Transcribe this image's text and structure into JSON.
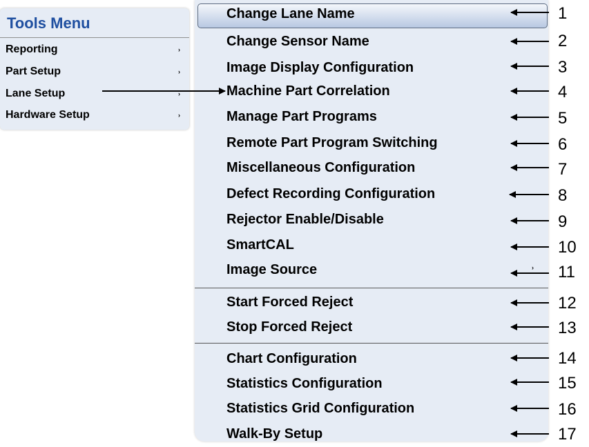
{
  "tools_menu": {
    "title": "Tools Menu",
    "items": [
      {
        "label": "Reporting",
        "submenu_glyph": "›"
      },
      {
        "label": "Part Setup",
        "submenu_glyph": "›"
      },
      {
        "label": "Lane Setup",
        "submenu_glyph": "›"
      },
      {
        "label": "Hardware Setup",
        "submenu_glyph": "›"
      }
    ]
  },
  "lane_setup_submenu": {
    "items": [
      {
        "label": "Change Lane Name",
        "callout": "1"
      },
      {
        "label": "Change Sensor Name",
        "callout": "2"
      },
      {
        "label": "Image Display Configuration",
        "callout": "3"
      },
      {
        "label": "Machine Part Correlation",
        "callout": "4"
      },
      {
        "label": "Manage Part Programs",
        "callout": "5"
      },
      {
        "label": "Remote Part Program Switching",
        "callout": "6"
      },
      {
        "label": "Miscellaneous Configuration",
        "callout": "7"
      },
      {
        "label": "Defect Recording Configuration",
        "callout": "8"
      },
      {
        "label": "Rejector Enable/Disable",
        "callout": "9"
      },
      {
        "label": "SmartCAL",
        "callout": "10"
      },
      {
        "label": "Image Source",
        "callout": "11",
        "submenu_glyph": "›"
      },
      {
        "label": "Start Forced Reject",
        "callout": "12"
      },
      {
        "label": "Stop Forced Reject",
        "callout": "13"
      },
      {
        "label": "Chart Configuration",
        "callout": "14"
      },
      {
        "label": "Statistics Configuration",
        "callout": "15"
      },
      {
        "label": "Statistics Grid Configuration",
        "callout": "16"
      },
      {
        "label": "Walk-By Setup",
        "callout": "17"
      }
    ]
  },
  "colors": {
    "title_blue": "#1f4fa0",
    "menu_bg": "#e6ecf5",
    "highlight_top": "#f4f7fb",
    "highlight_bottom": "#b8c8e2"
  }
}
